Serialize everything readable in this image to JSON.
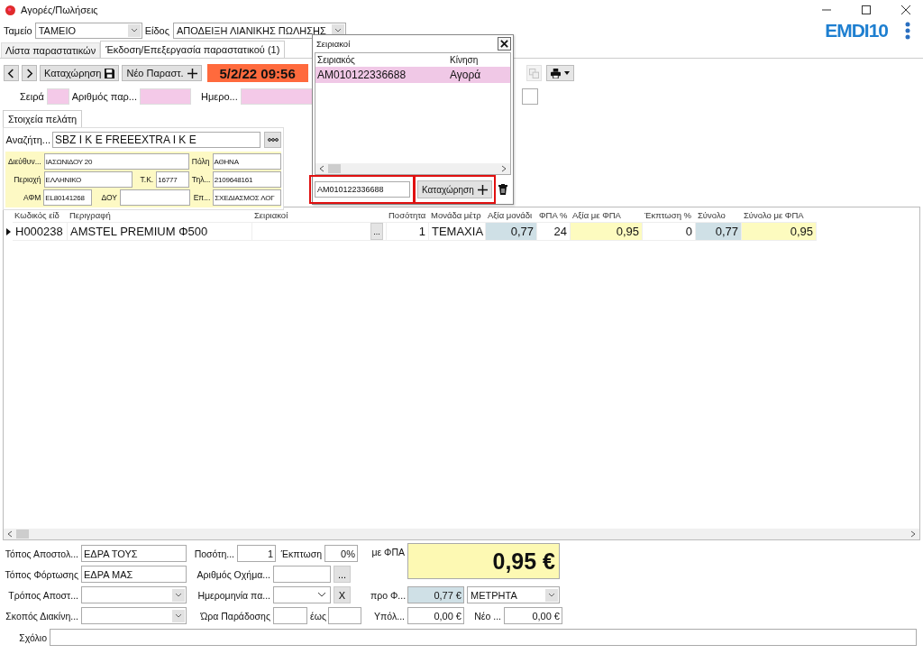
{
  "window": {
    "title": "Αγορές/Πωλήσεις",
    "logo": "EMDI10"
  },
  "header": [
    {
      "label": "Ταμείο",
      "value": "ΤΑΜΕΙΟ"
    },
    {
      "label": "Είδος",
      "value": "ΑΠΟΔΕΙΞΗ ΛΙΑΝΙΚΗΣ ΠΩΛΗΣΗΣ"
    }
  ],
  "tabs": [
    {
      "label": "Λίστα παραστατικών",
      "selected": false
    },
    {
      "label": "Έκδοση/Επεξεργασία παραστατικού (1)",
      "selected": true
    }
  ],
  "toolbar": [
    {
      "kind": "prev"
    },
    {
      "kind": "next"
    },
    {
      "kind": "save",
      "label": "Καταχώρηση"
    },
    {
      "kind": "new",
      "label": "Νέο Παραστ."
    }
  ],
  "date": "5/2/22 09:56",
  "tools": [
    {
      "kind": "copy",
      "disabled": true
    },
    {
      "kind": "print",
      "disabled": false
    }
  ],
  "doc_fields": [
    {
      "label": "Σειρά"
    },
    {
      "label": "Αριθμός παρ..."
    },
    {
      "label": "Ημερο..."
    }
  ],
  "customer": {
    "tab": "Στοιχεία πελάτη",
    "search_label": "Αναζήτη...",
    "search_value": "SBZ I K E  FREEEXTRA I K E",
    "fields": [
      {
        "label": "Διεύθυν...",
        "value": "ΙΑΣΩΝΙΔΟΥ 20"
      },
      {
        "label": "Πόλη",
        "value": "ΑΘΗΝΑ"
      },
      {
        "label": "Περιοχή",
        "value": "ΕΛΛΗΝΙΚΟ"
      },
      {
        "label": "Τ.Κ.",
        "value": "16777"
      },
      {
        "label": "Τηλ...",
        "value": "2109648161"
      },
      {
        "label": "ΑΦΜ",
        "value": "EL80141268"
      },
      {
        "label": "ΔΟΥ"
      },
      {
        "label": "Επ...",
        "value": "ΣΧΕΔΙΑΣΜΟΣ ΛΟΓ"
      }
    ]
  },
  "lines": {
    "columns": [
      "Κωδικός είδ",
      "Περιγραφή",
      "Σειριακοί",
      "Ποσότητα",
      "Μονάδα μέτρ",
      "Αξία μονάδι",
      "ΦΠΑ %",
      "Αξία με ΦΠΑ",
      "Έκπτωση %",
      "Σύνολο",
      "Σύνολο με ΦΠΑ"
    ],
    "rows": [
      {
        "current": true,
        "cells": [
          "H000238",
          "AMSTEL PREMIUM Φ500",
          "...",
          "1",
          "ΤΕΜΑΧΙΑ",
          "0,77",
          "24",
          "0,95",
          "0",
          "0,77",
          "0,95"
        ]
      }
    ]
  },
  "serials": {
    "title": "Σειριακοί",
    "columns": [
      "Σειριακός",
      "Κίνηση"
    ],
    "rows": [
      {
        "selected": true,
        "cells": [
          "AM010122336688",
          "Αγορά"
        ]
      }
    ],
    "input": "AM010122336688",
    "add_button": "Καταχώρηση"
  },
  "footer": {
    "left": [
      {
        "label": "Τόπος Αποστολ...",
        "kind": "text",
        "value": "ΕΔΡΑ ΤΟΥΣ"
      },
      {
        "label": "Τόπος Φόρτωσης",
        "kind": "text",
        "value": "ΕΔΡΑ ΜΑΣ"
      },
      {
        "label": "Τρόπος Αποστ...",
        "kind": "combo"
      },
      {
        "label": "Σκοπός Διακίνη...",
        "kind": "combo"
      }
    ],
    "quantity": {
      "label": "Ποσότη...",
      "value": "1"
    },
    "discount": {
      "label": "Έκπτωση",
      "value": "0%"
    },
    "vehicle": {
      "label": "Αριθμός Οχήμα...",
      "button": "..."
    },
    "delivery_date": {
      "label": "Ημερομηνία πα...",
      "button": "X"
    },
    "delivery_time": {
      "label": "Ώρα Παράδοσης",
      "to": "έως"
    },
    "total": {
      "label": "με ΦΠΑ",
      "value": "0,95 €"
    },
    "net": {
      "label": "προ Φ...",
      "value": "0,77 €"
    },
    "payment": "ΜΕΤΡΗΤΑ",
    "balance": {
      "label": "Υπόλ...",
      "value": "0,00 €"
    },
    "new_balance": {
      "label": "Νέο ...",
      "value": "0,00 €"
    },
    "comment": {
      "label": "Σχόλιο"
    }
  }
}
